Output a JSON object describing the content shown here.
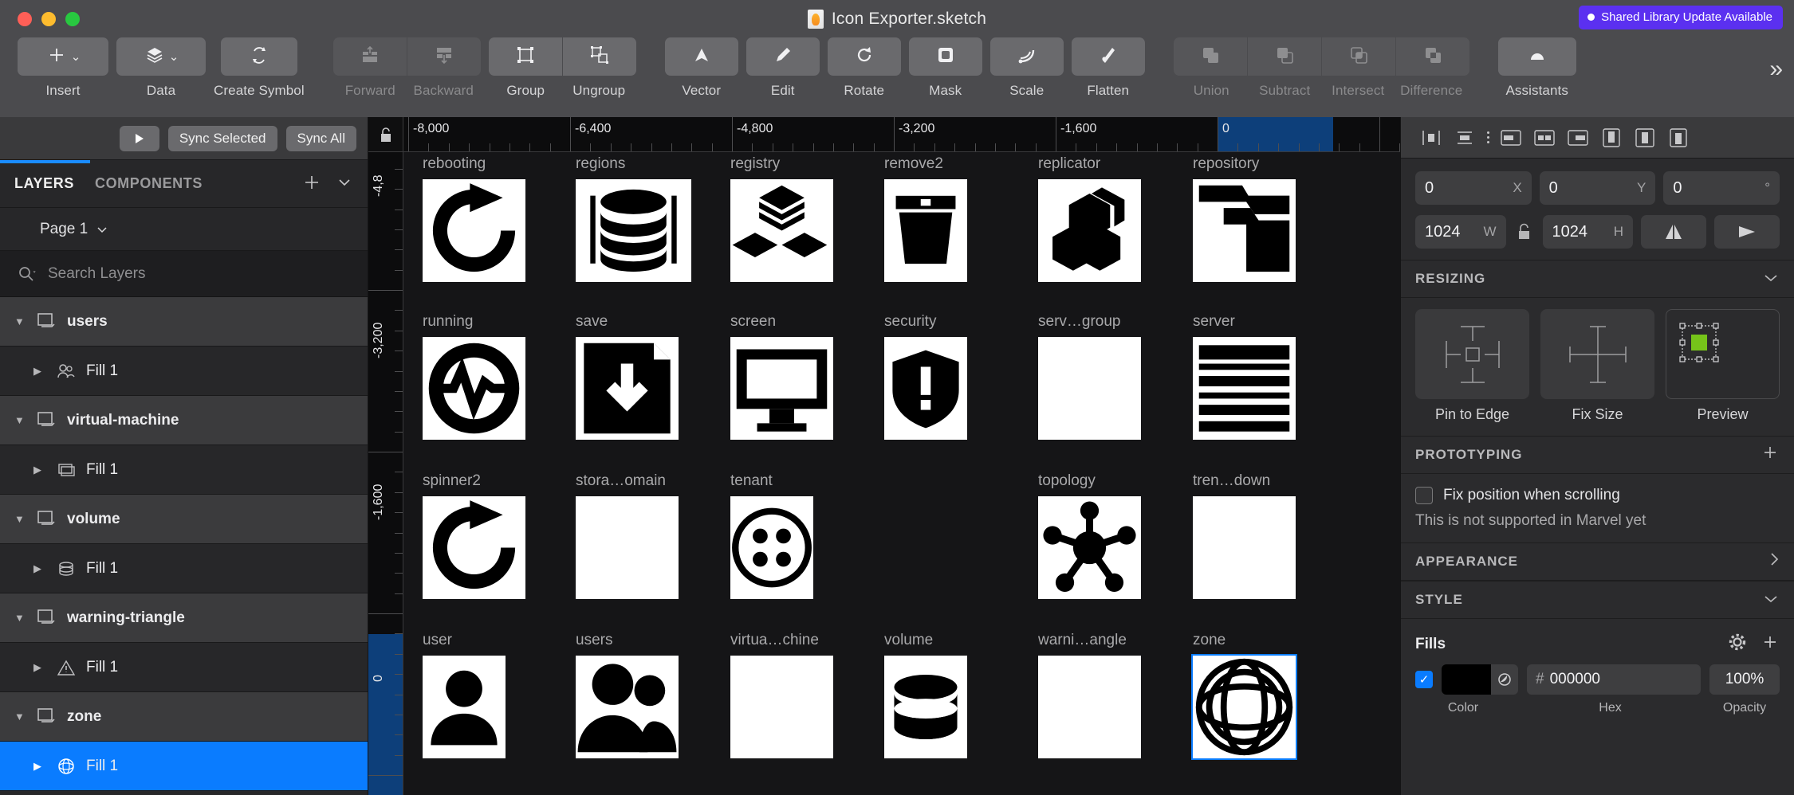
{
  "window": {
    "title": "Icon Exporter.sketch",
    "badge": "Shared Library Update Available",
    "accent": "#5b30f0"
  },
  "toolbar": {
    "groups": [
      {
        "label": "Insert",
        "icon": "plus-icon",
        "dim": false,
        "dropdown": true
      },
      {
        "label": "Data",
        "icon": "data-cube-icon",
        "dim": false,
        "dropdown": true
      },
      {
        "label": "Create Symbol",
        "icon": "create-symbol-icon",
        "dim": false,
        "dropdown": false
      },
      {
        "label": "Forward",
        "icon": "move-forward-icon",
        "dim": true,
        "dropdown": false
      },
      {
        "label": "Backward",
        "icon": "move-backward-icon",
        "dim": true,
        "dropdown": false
      },
      {
        "label": "Group",
        "icon": "group-icon",
        "dim": false,
        "dropdown": false
      },
      {
        "label": "Ungroup",
        "icon": "ungroup-icon",
        "dim": false,
        "dropdown": false
      },
      {
        "label": "Vector",
        "icon": "vector-pen-icon",
        "dim": false,
        "dropdown": false
      },
      {
        "label": "Edit",
        "icon": "edit-pencil-icon",
        "dim": false,
        "dropdown": false
      },
      {
        "label": "Rotate",
        "icon": "rotate-icon",
        "dim": false,
        "dropdown": false
      },
      {
        "label": "Mask",
        "icon": "mask-icon",
        "dim": false,
        "dropdown": false
      },
      {
        "label": "Scale",
        "icon": "scale-icon",
        "dim": false,
        "dropdown": false
      },
      {
        "label": "Flatten",
        "icon": "flatten-icon",
        "dim": false,
        "dropdown": false
      },
      {
        "label": "Union",
        "icon": "union-icon",
        "dim": true,
        "dropdown": false
      },
      {
        "label": "Subtract",
        "icon": "subtract-icon",
        "dim": true,
        "dropdown": false
      },
      {
        "label": "Intersect",
        "icon": "intersect-icon",
        "dim": true,
        "dropdown": false
      },
      {
        "label": "Difference",
        "icon": "difference-icon",
        "dim": true,
        "dropdown": false
      },
      {
        "label": "Assistants",
        "icon": "assistants-icon",
        "dim": false,
        "dropdown": false
      }
    ],
    "overflow": "»"
  },
  "left_panel": {
    "sync_selected": "Sync Selected",
    "sync_all": "Sync All",
    "tabs": {
      "layers": "LAYERS",
      "components": "COMPONENTS"
    },
    "page": "Page 1",
    "search_placeholder": "Search Layers",
    "layers": [
      {
        "name": "users",
        "type": "group",
        "icon": "artboard-icon",
        "expanded": true,
        "selected": false
      },
      {
        "name": "Fill 1",
        "type": "child",
        "icon": "users-shape-icon",
        "expanded": false,
        "selected": false
      },
      {
        "name": "virtual-machine",
        "type": "group",
        "icon": "artboard-icon",
        "expanded": true,
        "selected": false
      },
      {
        "name": "Fill 1",
        "type": "child",
        "icon": "vm-shape-icon",
        "expanded": false,
        "selected": false
      },
      {
        "name": "volume",
        "type": "group",
        "icon": "artboard-icon",
        "expanded": true,
        "selected": false
      },
      {
        "name": "Fill 1",
        "type": "child",
        "icon": "volume-shape-icon",
        "expanded": false,
        "selected": false
      },
      {
        "name": "warning-triangle",
        "type": "group",
        "icon": "artboard-icon",
        "expanded": true,
        "selected": false
      },
      {
        "name": "Fill 1",
        "type": "child",
        "icon": "warning-shape-icon",
        "expanded": false,
        "selected": false
      },
      {
        "name": "zone",
        "type": "group",
        "icon": "artboard-icon",
        "expanded": true,
        "selected": false
      },
      {
        "name": "Fill 1",
        "type": "child",
        "icon": "zone-shape-icon",
        "expanded": false,
        "selected": true
      }
    ]
  },
  "rulers": {
    "horizontal": [
      "-8,000",
      "-6,400",
      "-4,800",
      "-3,200",
      "-1,600",
      "0"
    ],
    "vertical": [
      "-4,8",
      "-3,200",
      "-1,600",
      "0"
    ],
    "selection_color": "#0d3f7a"
  },
  "canvas": {
    "rows": [
      [
        "rebooting",
        "regions",
        "registry",
        "remove2",
        "replicator",
        "repository"
      ],
      [
        "running",
        "save",
        "screen",
        "security",
        "serv…group",
        "server"
      ],
      [
        "spinner2",
        "stora…omain",
        "tenant",
        "",
        "topology",
        "tren…down"
      ],
      [
        "user",
        "users",
        "virtua…chine",
        "volume",
        "warni…angle",
        "zone"
      ]
    ],
    "selected_artboard": "zone"
  },
  "inspector": {
    "position": {
      "x": "0",
      "y": "0",
      "rotation": "0",
      "x_unit": "X",
      "y_unit": "Y",
      "rot_unit": "°"
    },
    "size": {
      "w": "1024",
      "h": "1024",
      "w_unit": "W",
      "h_unit": "H"
    },
    "resizing": {
      "title": "RESIZING",
      "options": [
        {
          "label": "Pin to Edge",
          "icon": "pin-to-edge-icon"
        },
        {
          "label": "Fix Size",
          "icon": "fix-size-icon"
        },
        {
          "label": "Preview",
          "icon": "resize-preview-icon"
        }
      ],
      "preview_color": "#76c41a"
    },
    "prototyping": {
      "title": "PROTOTYPING",
      "fix_position_label": "Fix position when scrolling",
      "fix_position_checked": false,
      "note": "This is not supported in Marvel yet"
    },
    "appearance": {
      "title": "APPEARANCE"
    },
    "style": {
      "title": "STYLE",
      "fills_title": "Fills",
      "fill": {
        "enabled": true,
        "color": "#000000",
        "hex": "000000",
        "hash": "#",
        "opacity": "100%"
      },
      "captions": {
        "color": "Color",
        "hex": "Hex",
        "opacity": "Opacity"
      }
    }
  }
}
